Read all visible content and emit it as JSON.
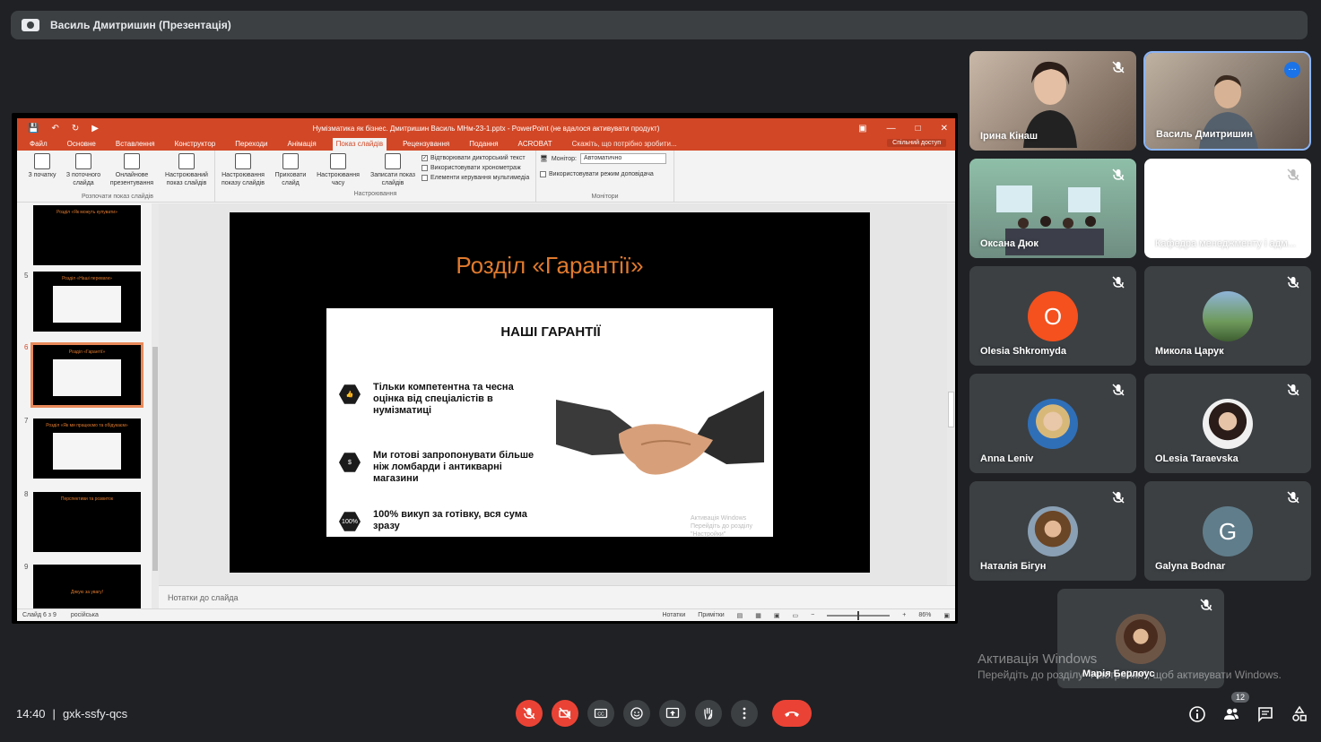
{
  "presenter": {
    "title": "Василь Дмитришин (Презентація)"
  },
  "ppt": {
    "doc_title": "Нумізматика як бізнес. Дмитришин Василь МНм-23-1.pptx  -  PowerPoint (не вдалося активувати продукт)",
    "tabs": [
      "Файл",
      "Основне",
      "Вставлення",
      "Конструктор",
      "Переходи",
      "Анімація",
      "Показ слайдів",
      "Рецензування",
      "Подання",
      "ACROBAT"
    ],
    "active_tab": "Показ слайдів",
    "tell_me": "Скажіть, що потрібно зробити...",
    "share": "Спільний доступ",
    "ribbon": {
      "group_start": {
        "label": "Розпочати показ слайдів",
        "buttons": [
          "З початку",
          "З поточного слайда",
          "Онлайнове презентування",
          "Настроюваний показ слайдів"
        ]
      },
      "group_setup": {
        "label": "Настроювання",
        "buttons": [
          "Настроювання показу слайдів",
          "Приховати слайд",
          "Настроювання часу",
          "Записати показ слайдів"
        ],
        "checkboxes": [
          {
            "label": "Відтворювати дикторський текст",
            "checked": true
          },
          {
            "label": "Використовувати хронометраж",
            "checked": false
          },
          {
            "label": "Елементи керування мультимедіа",
            "checked": false
          }
        ]
      },
      "group_monitors": {
        "label": "Монітори",
        "monitor_label": "Монітор:",
        "monitor_value": "Автоматично",
        "presenter_view": "Використовувати режим доповідача"
      }
    },
    "thumbs": [
      {
        "num": "",
        "title": "Розділ «Як можуть купувати»"
      },
      {
        "num": "5",
        "title": "Розділ «Наші переваги»"
      },
      {
        "num": "6",
        "title": "Розділ «Гарантії»"
      },
      {
        "num": "7",
        "title": "Розділ «Як ми працюємо та обідукаєм»"
      },
      {
        "num": "8",
        "title": "Перспективи та розвиток"
      },
      {
        "num": "9",
        "title": "Дякую за увагу!"
      }
    ],
    "slide": {
      "title": "Розділ «Гарантії»",
      "card_title": "НАШІ ГАРАНТІЇ",
      "items": [
        {
          "icon": "thumbs-up-icon",
          "text": "Тільки компетентна та чесна оцінка від спеціалістів в нумізматиці"
        },
        {
          "icon": "money-bag-icon",
          "text": "Ми готові запропонувати більше ніж ломбарди і антикварні магазини"
        },
        {
          "icon": "percent-icon",
          "badge": "100%",
          "text": "100% викуп за готівку, вся сума зразу"
        }
      ],
      "watermark_line1": "Активація Windows",
      "watermark_line2": "Перейдіть до розділу \"Настройки\""
    },
    "notes_placeholder": "Нотатки до слайда",
    "status": {
      "slide_of": "Слайд 6 з 9",
      "language": "російська",
      "notes": "Нотатки",
      "comments": "Примітки",
      "zoom": "86%"
    }
  },
  "participants": [
    {
      "name": "Ірина Кінаш",
      "type": "video",
      "muted": true
    },
    {
      "name": "Василь Дмитришин",
      "type": "video",
      "muted": false,
      "active": true
    },
    {
      "name": "Оксана Дюк",
      "type": "video",
      "muted": true
    },
    {
      "name": "Кафедра менеджменту і адм...",
      "type": "blank",
      "muted": true
    },
    {
      "name": "Olesia Shkromyda",
      "type": "letter",
      "letter": "O",
      "color": "#f4511e",
      "muted": true
    },
    {
      "name": "Микола Царук",
      "type": "photo",
      "muted": true
    },
    {
      "name": "Anna Leniv",
      "type": "photo",
      "muted": true
    },
    {
      "name": "OLesia Taraevska",
      "type": "photo",
      "muted": true
    },
    {
      "name": "Наталія Бігун",
      "type": "photo",
      "muted": true
    },
    {
      "name": "Galyna Bodnar",
      "type": "letter",
      "letter": "G",
      "color": "#607d8b",
      "muted": true
    },
    {
      "name": "Марія Берлоус",
      "type": "photo",
      "muted": true
    }
  ],
  "windows_activation": {
    "line1": "Активація Windows",
    "line2": "Перейдіть до розділу \"Настройки\", щоб активувати Windows."
  },
  "meeting": {
    "time": "14:40",
    "separator": "|",
    "code": "gxk-ssfy-qcs",
    "participant_count": "12"
  },
  "colors": {
    "background": "#202124",
    "tile": "#3c4043",
    "ppt_accent": "#d24726",
    "slide_title": "#e07a2e",
    "end_call": "#ea4335"
  }
}
